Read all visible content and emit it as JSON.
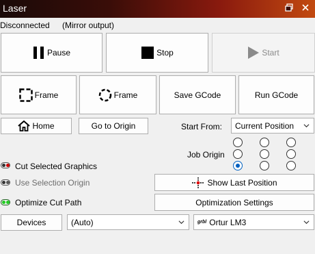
{
  "window": {
    "title": "Laser"
  },
  "status": {
    "connection": "Disconnected",
    "mode": "(Mirror output)"
  },
  "buttons": {
    "pause": "Pause",
    "stop": "Stop",
    "start": "Start",
    "frame_rect": "Frame",
    "frame_circle": "Frame",
    "save_gcode": "Save GCode",
    "run_gcode": "Run GCode",
    "home": "Home",
    "go_to_origin": "Go to Origin",
    "show_last_position": "Show Last Position",
    "optimization_settings": "Optimization Settings",
    "devices": "Devices"
  },
  "start_from": {
    "label": "Start From:",
    "value": "Current Position"
  },
  "job_origin": {
    "label": "Job Origin",
    "selected_row": 2,
    "selected_col": 0
  },
  "toggles": {
    "cut_selected_graphics": {
      "label": "Cut Selected Graphics",
      "state": "on",
      "color": "#cc0000"
    },
    "use_selection_origin": {
      "label": "Use Selection Origin",
      "state": "off",
      "color": "#333333"
    },
    "optimize_cut_path": {
      "label": "Optimize Cut Path",
      "state": "on",
      "color": "#22cc22"
    }
  },
  "port_select": {
    "value": "(Auto)"
  },
  "device_select": {
    "value": "Ortur LM3",
    "badge": "grbl"
  }
}
